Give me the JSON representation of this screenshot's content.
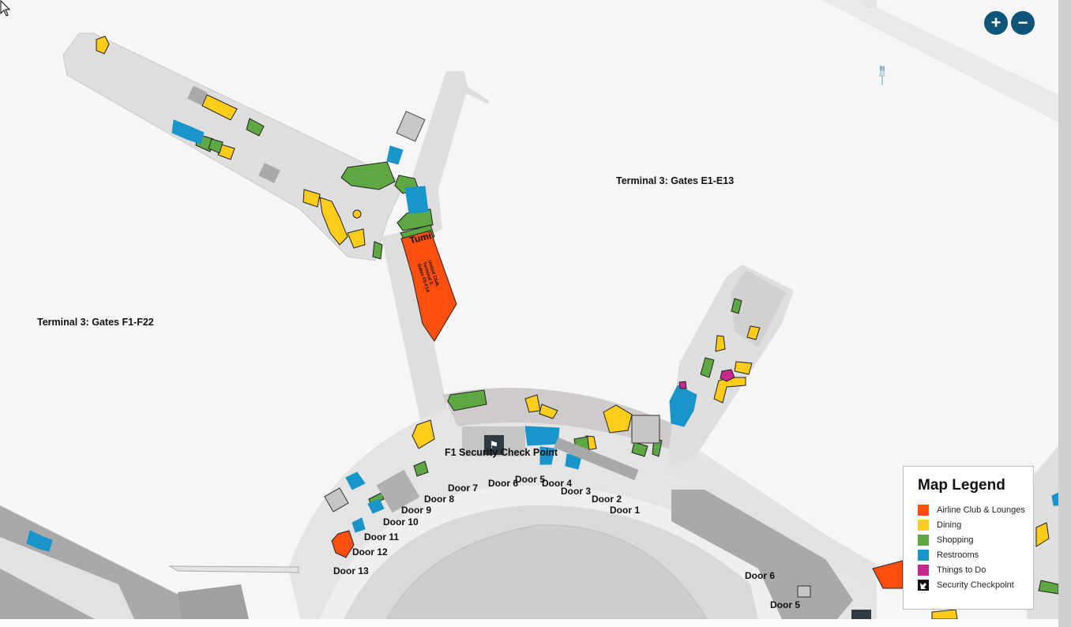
{
  "map": {
    "terminal_labels": [
      "Terminal 3: Gates E1-E13",
      "Terminal 3: Gates F1-F22"
    ],
    "checkpoint_label": "F1 Security Check Point",
    "store_labels": [
      "Tumi",
      "United Club, Terminal 3, Gates F5-F14"
    ],
    "door_labels": [
      "Door 1",
      "Door 2",
      "Door 3",
      "Door 4",
      "Door 5",
      "Door 6",
      "Door 7",
      "Door 8",
      "Door 9",
      "Door 10",
      "Door 11",
      "Door 12",
      "Door 13",
      "Door 6",
      "Door 5"
    ],
    "north_label": "N"
  },
  "controls": {
    "zoom_in": "+",
    "zoom_out": "−"
  },
  "legend": {
    "title": "Map Legend",
    "items": [
      {
        "label": "Airline Club & Lounges",
        "color": "#ff4f0f",
        "icon": "square-swatch"
      },
      {
        "label": "Dining",
        "color": "#ffcc1a",
        "icon": "square-swatch"
      },
      {
        "label": "Shopping",
        "color": "#5ea743",
        "icon": "square-swatch"
      },
      {
        "label": "Restrooms",
        "color": "#1a95c9",
        "icon": "square-swatch"
      },
      {
        "label": "Things to Do",
        "color": "#c8288e",
        "icon": "square-swatch"
      },
      {
        "label": "Security Checkpoint",
        "color": "#111111",
        "icon": "security-checkpoint-icon"
      }
    ]
  },
  "colors": {
    "background": "#f6f6f6",
    "concourse": "#dedede",
    "building": "#a8a8a8",
    "control_accent": "#0f5479"
  }
}
